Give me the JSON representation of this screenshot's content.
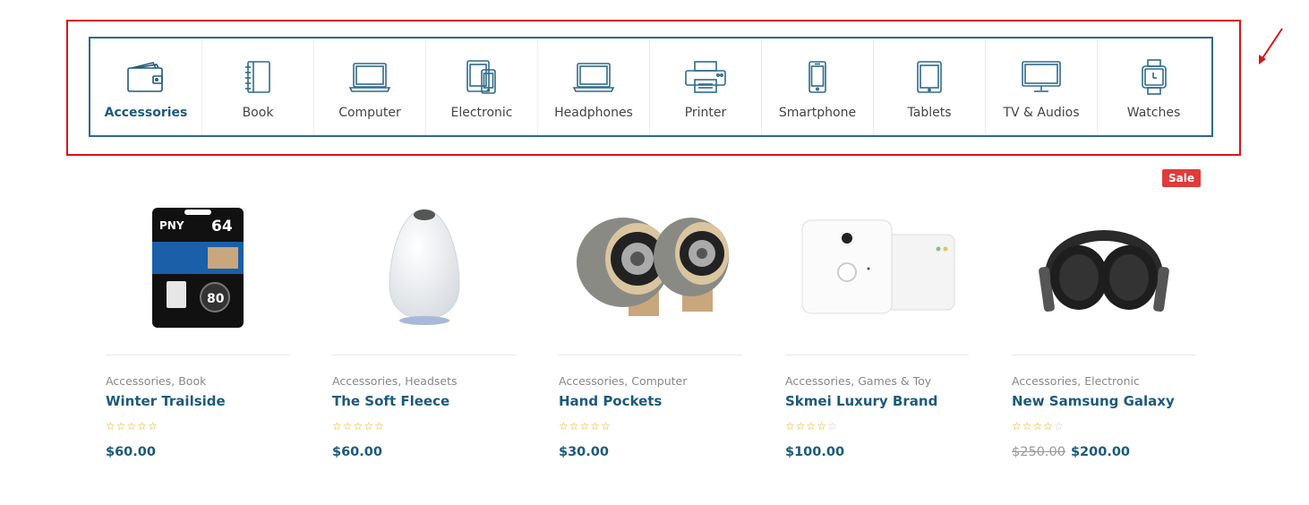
{
  "categories": [
    {
      "label": "Accessories",
      "icon": "wallet-icon",
      "active": true
    },
    {
      "label": "Book",
      "icon": "notebook-icon"
    },
    {
      "label": "Computer",
      "icon": "laptop-icon"
    },
    {
      "label": "Electronic",
      "icon": "devices-icon"
    },
    {
      "label": "Headphones",
      "icon": "laptop-icon"
    },
    {
      "label": "Printer",
      "icon": "printer-icon"
    },
    {
      "label": "Smartphone",
      "icon": "smartphone-icon"
    },
    {
      "label": "Tablets",
      "icon": "tablet-icon"
    },
    {
      "label": "TV & Audios",
      "icon": "tv-icon"
    },
    {
      "label": "Watches",
      "icon": "watch-icon"
    }
  ],
  "products": [
    {
      "cat1": "Accessories",
      "cat2": "Book",
      "title": "Winter Trailside",
      "rating": 0,
      "price": "$60.00",
      "image": "sd-card-image"
    },
    {
      "cat1": "Accessories",
      "cat2": "Headsets",
      "title": "The Soft Fleece",
      "rating": 0,
      "price": "$60.00",
      "image": "smart-speaker-image"
    },
    {
      "cat1": "Accessories",
      "cat2": "Computer",
      "title": "Hand Pockets",
      "rating": 0,
      "price": "$30.00",
      "image": "wooden-speakers-image"
    },
    {
      "cat1": "Accessories",
      "cat2": "Games & Toy",
      "title": "Skmei Luxury Brand",
      "rating": 4,
      "price": "$100.00",
      "image": "blink-camera-image"
    },
    {
      "cat1": "Accessories",
      "cat2": "Electronic",
      "title": "New Samsung Galaxy",
      "rating": 4,
      "old_price": "$250.00",
      "price": "$200.00",
      "image": "headphones-image"
    }
  ],
  "sale_badge": "Sale",
  "colors": {
    "accent": "#1e5a7c",
    "border": "#2f6a8c",
    "highlight": "#d9141b",
    "sale": "#e03b3b",
    "star": "#e6a700"
  }
}
